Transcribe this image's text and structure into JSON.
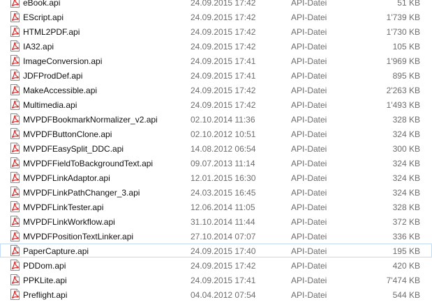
{
  "files": [
    {
      "name": "eBook.api",
      "modified": "24.09.2015 17:42",
      "type": "API-Datei",
      "size": "51 KB"
    },
    {
      "name": "EScript.api",
      "modified": "24.09.2015 17:42",
      "type": "API-Datei",
      "size": "1'739 KB"
    },
    {
      "name": "HTML2PDF.api",
      "modified": "24.09.2015 17:42",
      "type": "API-Datei",
      "size": "1'730 KB"
    },
    {
      "name": "IA32.api",
      "modified": "24.09.2015 17:42",
      "type": "API-Datei",
      "size": "105 KB"
    },
    {
      "name": "ImageConversion.api",
      "modified": "24.09.2015 17:41",
      "type": "API-Datei",
      "size": "1'969 KB"
    },
    {
      "name": "JDFProdDef.api",
      "modified": "24.09.2015 17:41",
      "type": "API-Datei",
      "size": "895 KB"
    },
    {
      "name": "MakeAccessible.api",
      "modified": "24.09.2015 17:42",
      "type": "API-Datei",
      "size": "2'263 KB"
    },
    {
      "name": "Multimedia.api",
      "modified": "24.09.2015 17:42",
      "type": "API-Datei",
      "size": "1'493 KB"
    },
    {
      "name": "MVPDFBookmarkNormalizer_v2.api",
      "modified": "02.10.2014 11:36",
      "type": "API-Datei",
      "size": "328 KB"
    },
    {
      "name": "MVPDFButtonClone.api",
      "modified": "02.10.2012 10:51",
      "type": "API-Datei",
      "size": "324 KB"
    },
    {
      "name": "MVPDFEasySplit_DDC.api",
      "modified": "14.08.2012 06:54",
      "type": "API-Datei",
      "size": "300 KB"
    },
    {
      "name": "MVPDFFieldToBackgroundText.api",
      "modified": "09.07.2013 11:14",
      "type": "API-Datei",
      "size": "324 KB"
    },
    {
      "name": "MVPDFLinkAdaptor.api",
      "modified": "12.01.2015 16:30",
      "type": "API-Datei",
      "size": "324 KB"
    },
    {
      "name": "MVPDFLinkPathChanger_3.api",
      "modified": "24.03.2015 16:45",
      "type": "API-Datei",
      "size": "324 KB"
    },
    {
      "name": "MVPDFLinkTester.api",
      "modified": "12.06.2014 11:05",
      "type": "API-Datei",
      "size": "328 KB"
    },
    {
      "name": "MVPDFLinkWorkflow.api",
      "modified": "31.10.2014 11:44",
      "type": "API-Datei",
      "size": "372 KB"
    },
    {
      "name": "MVPDFPositionTextLinker.api",
      "modified": "27.10.2014 07:07",
      "type": "API-Datei",
      "size": "336 KB"
    },
    {
      "name": "PaperCapture.api",
      "modified": "24.09.2015 17:40",
      "type": "API-Datei",
      "size": "195 KB"
    },
    {
      "name": "PDDom.api",
      "modified": "24.09.2015 17:42",
      "type": "API-Datei",
      "size": "420 KB"
    },
    {
      "name": "PPKLite.api",
      "modified": "24.09.2015 17:41",
      "type": "API-Datei",
      "size": "7'474 KB"
    },
    {
      "name": "Preflight.api",
      "modified": "04.04.2012 07:54",
      "type": "API-Datei",
      "size": "544 KB"
    }
  ],
  "focused_index": 17,
  "file_icon": "pdf-file-icon",
  "colors": {
    "icon_red": "#d32f2f",
    "focus_border": "#c3d9f2",
    "secondary_text": "#6d6d6d"
  }
}
